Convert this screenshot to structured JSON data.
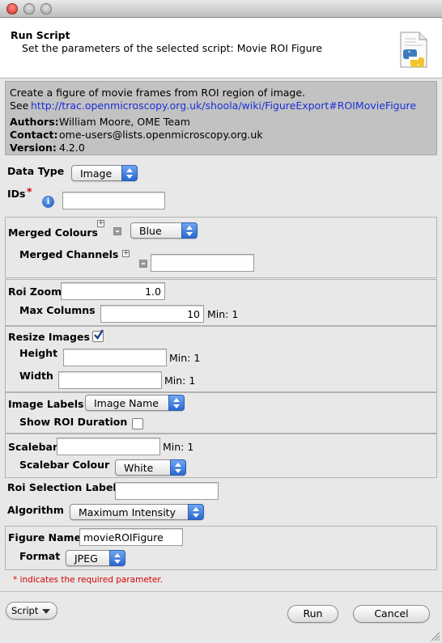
{
  "window": {
    "traffic_lights": [
      {
        "name": "close",
        "color": "#e0443e"
      },
      {
        "name": "minimize",
        "color": "#b9b9b9"
      },
      {
        "name": "zoom",
        "color": "#b9b9b9"
      }
    ]
  },
  "header": {
    "title": "Run Script",
    "subtitle": "Set the parameters of the selected script: Movie ROI Figure",
    "icon": "python-script-icon"
  },
  "info": {
    "description": "Create a figure of movie frames from ROI region of image.",
    "see_label": "See",
    "link": "http://trac.openmicroscopy.org.uk/shoola/wiki/FigureExport#ROIMovieFigure",
    "authors_label": "Authors:",
    "authors": "William Moore, OME Team",
    "contact_label": "Contact:",
    "contact": "ome-users@lists.openmicroscopy.org.uk",
    "version_label": "Version:",
    "version": "4.2.0"
  },
  "params": {
    "data_type_label": "Data Type",
    "data_type_value": "Image",
    "ids_label": "IDs",
    "ids_required": "*",
    "ids_value": "",
    "merged_colours_label": "Merged Colours",
    "merged_colours_value": "Blue",
    "merged_channels_label": "Merged Channels",
    "merged_channels_value": "",
    "roi_zoom_label": "Roi Zoom",
    "roi_zoom_value": "1.0",
    "max_columns_label": "Max Columns",
    "max_columns_value": "10",
    "max_columns_min": "Min: 1",
    "resize_images_label": "Resize Images",
    "resize_images_checked": true,
    "height_label": "Height",
    "height_value": "",
    "height_min": "Min: 1",
    "width_label": "Width",
    "width_value": "",
    "width_min": "Min: 1",
    "image_labels_label": "Image Labels",
    "image_labels_value": "Image Name",
    "show_roi_duration_label": "Show ROI Duration",
    "show_roi_duration_checked": false,
    "scalebar_label": "Scalebar",
    "scalebar_value": "",
    "scalebar_min": "Min: 1",
    "scalebar_colour_label": "Scalebar Colour",
    "scalebar_colour_value": "White",
    "roi_selection_label_label": "Roi Selection Label",
    "roi_selection_label_value": "",
    "algorithm_label": "Algorithm",
    "algorithm_value": "Maximum Intensity",
    "figure_name_label": "Figure Name",
    "figure_name_value": "movieROIFigure",
    "format_label": "Format",
    "format_value": "JPEG"
  },
  "footer": {
    "required_note": "* indicates the required parameter.",
    "script_menu": "Script",
    "run_button": "Run",
    "cancel_button": "Cancel"
  },
  "colors": {
    "required": "#d40000",
    "link": "#1a2fd6",
    "info_bg": "#c2c2c2",
    "select_accent": "#2a67d3"
  }
}
